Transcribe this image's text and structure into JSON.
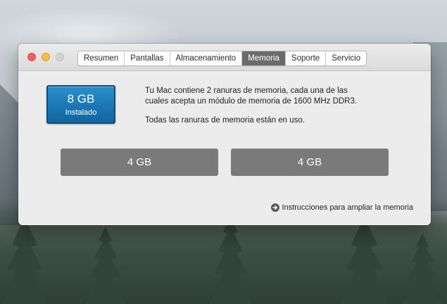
{
  "window": {
    "tabs": [
      {
        "label": "Resumen",
        "active": false
      },
      {
        "label": "Pantallas",
        "active": false
      },
      {
        "label": "Almacenamiento",
        "active": false
      },
      {
        "label": "Memoria",
        "active": true
      },
      {
        "label": "Soporte",
        "active": false
      },
      {
        "label": "Servicio",
        "active": false
      }
    ]
  },
  "memory": {
    "installed_amount": "8 GB",
    "installed_label": "Instalado",
    "description_line1": "Tu Mac contiene 2 ranuras de memoria, cada una de las",
    "description_line2": "cuales acepta un módulo de memoria de 1600 MHz DDR3.",
    "status": "Todas las ranuras de memoria están en uso.",
    "slots": [
      "4 GB",
      "4 GB"
    ],
    "upgrade_link": "Instrucciones para ampliar la memoria"
  },
  "icons": {
    "close": "close-button",
    "minimize": "minimize-button",
    "zoom": "zoom-button",
    "arrow": "arrow-circle-right-icon"
  },
  "colors": {
    "installed_box": "#1b77b4",
    "active_tab": "#6b6b6b",
    "slot": "#7a7a7a",
    "close": "#fc605b",
    "minimize": "#fdbc40"
  }
}
